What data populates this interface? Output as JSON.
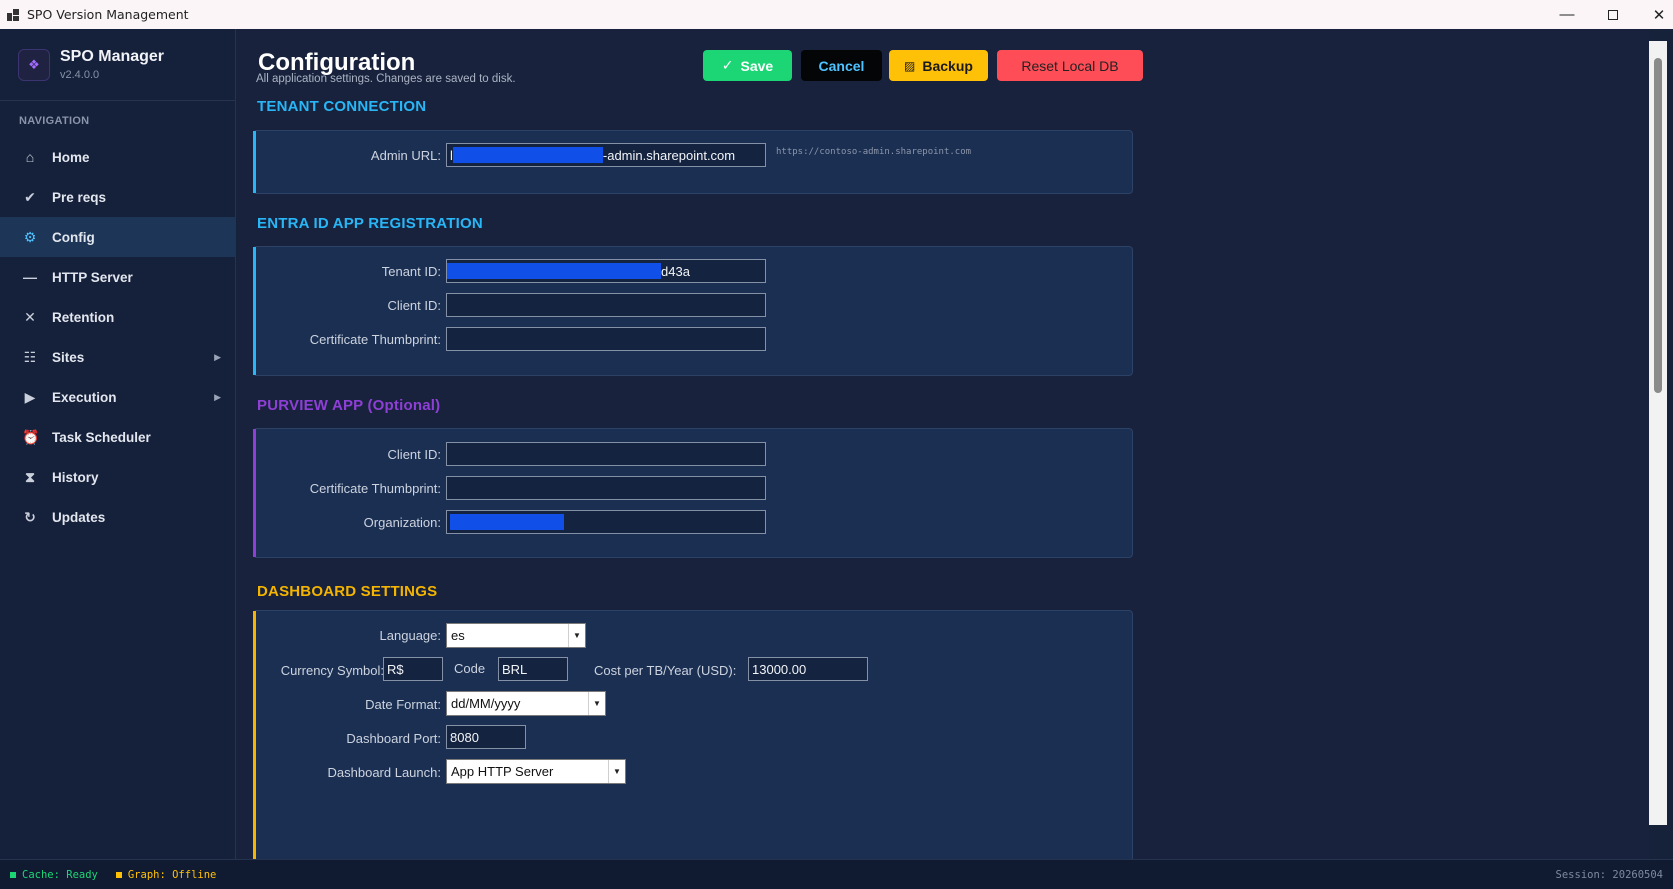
{
  "window": {
    "title": "SPO Version Management"
  },
  "sidebar": {
    "brand_name": "SPO Manager",
    "brand_version": "v2.4.0.0",
    "nav_header": "NAVIGATION",
    "items": [
      {
        "label": "Home",
        "icon": "home-icon",
        "glyph": "⌂"
      },
      {
        "label": "Pre reqs",
        "icon": "check-icon",
        "glyph": "✔"
      },
      {
        "label": "Config",
        "icon": "gear-icon",
        "glyph": "⚙",
        "active": true
      },
      {
        "label": "HTTP Server",
        "icon": "minus-icon",
        "glyph": "—"
      },
      {
        "label": "Retention",
        "icon": "x-icon",
        "glyph": "✕"
      },
      {
        "label": "Sites",
        "icon": "list-icon",
        "glyph": "☷",
        "expandable": true
      },
      {
        "label": "Execution",
        "icon": "play-icon",
        "glyph": "▶",
        "expandable": true
      },
      {
        "label": "Task Scheduler",
        "icon": "alarm-clock-icon",
        "glyph": "⏰"
      },
      {
        "label": "History",
        "icon": "hourglass-icon",
        "glyph": "⧗"
      },
      {
        "label": "Updates",
        "icon": "refresh-icon",
        "glyph": "↻"
      }
    ]
  },
  "page": {
    "title": "Configuration",
    "subtitle": "All application settings. Changes are saved to disk."
  },
  "toolbar": {
    "save_label": "Save",
    "save_glyph": "✓",
    "cancel_label": "Cancel",
    "backup_label": "Backup",
    "backup_glyph": "▨",
    "reset_label": "Reset Local DB"
  },
  "sections": {
    "tenant": {
      "title": "TENANT CONNECTION",
      "accent": "#29b6f6",
      "admin_url_label": "Admin URL:",
      "admin_url_prefix": "l",
      "admin_url_value": "-admin.sharepoint.com",
      "admin_url_hint": "https://contoso-admin.sharepoint.com"
    },
    "entra": {
      "title": "ENTRA ID APP REGISTRATION",
      "accent": "#29b6f6",
      "tenant_id_label": "Tenant ID:",
      "tenant_id_value": "d43a",
      "client_id_label": "Client ID:",
      "client_id_value": "",
      "thumbprint_label": "Certificate Thumbprint:",
      "thumbprint_value": ""
    },
    "purview": {
      "title": "PURVIEW APP (Optional)",
      "accent": "#8e3fd6",
      "client_id_label": "Client ID:",
      "client_id_value": "",
      "thumbprint_label": "Certificate Thumbprint:",
      "thumbprint_value": "",
      "organization_label": "Organization:",
      "organization_value": ""
    },
    "dashboard": {
      "title": "DASHBOARD SETTINGS",
      "accent": "#f4b400",
      "language_label": "Language:",
      "language_value": "es",
      "currency_symbol_label": "Currency Symbol:",
      "currency_symbol_value": "R$",
      "code_label": "Code",
      "code_value": "BRL",
      "cost_label": "Cost per TB/Year (USD):",
      "cost_value": "13000.00",
      "date_format_label": "Date Format:",
      "date_format_value": "dd/MM/yyyy",
      "port_label": "Dashboard Port:",
      "port_value": "8080",
      "launch_label": "Dashboard Launch:",
      "launch_value": "App HTTP Server"
    }
  },
  "status": {
    "cache": "Cache: Ready",
    "cache_color": "#1cd676",
    "graph": "Graph: Offline",
    "graph_color": "#ffc107",
    "session": "Session: 20260504"
  },
  "colors": {
    "tenant_title": "#29b6f6",
    "purview_title": "#8e3fd6",
    "dashboard_title": "#f4b400"
  }
}
